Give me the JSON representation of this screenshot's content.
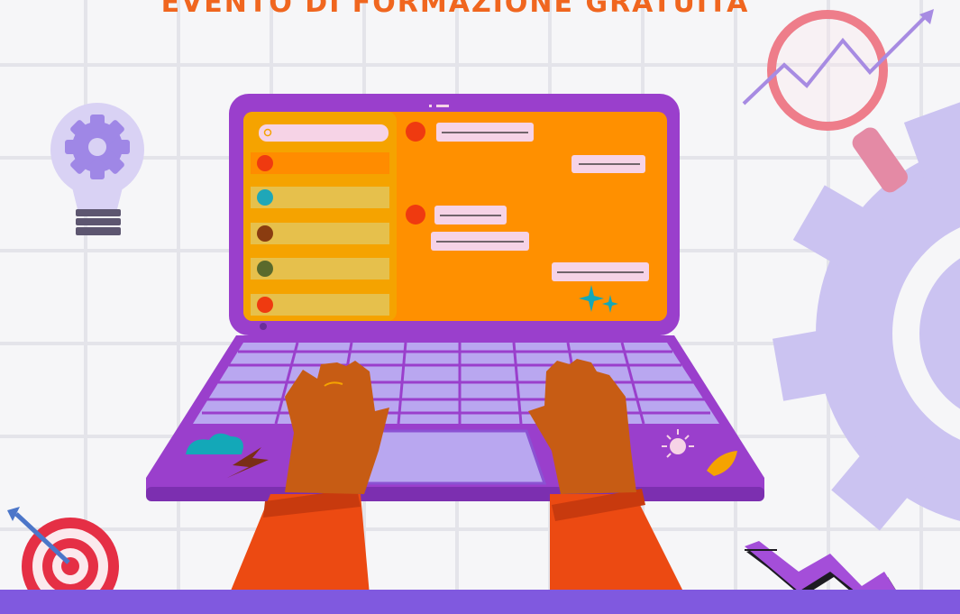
{
  "headline": "EVENTO DI FORMAZIONE GRATUITA",
  "colors": {
    "headline": "#f0661f",
    "laptop": "#9a3fcc",
    "screen": "#ff9000",
    "sidebar": "#f5a300",
    "bubble": "#f6d3e6",
    "bottom_bar": "#8059df",
    "gear": "#cbc3f1"
  },
  "icons": [
    "lightbulb-gear-icon",
    "magnifier-growth-icon",
    "large-gear-icon",
    "target-arrow-icon",
    "zigzag-arrow-icon",
    "laptop-icon",
    "hands-icon"
  ]
}
